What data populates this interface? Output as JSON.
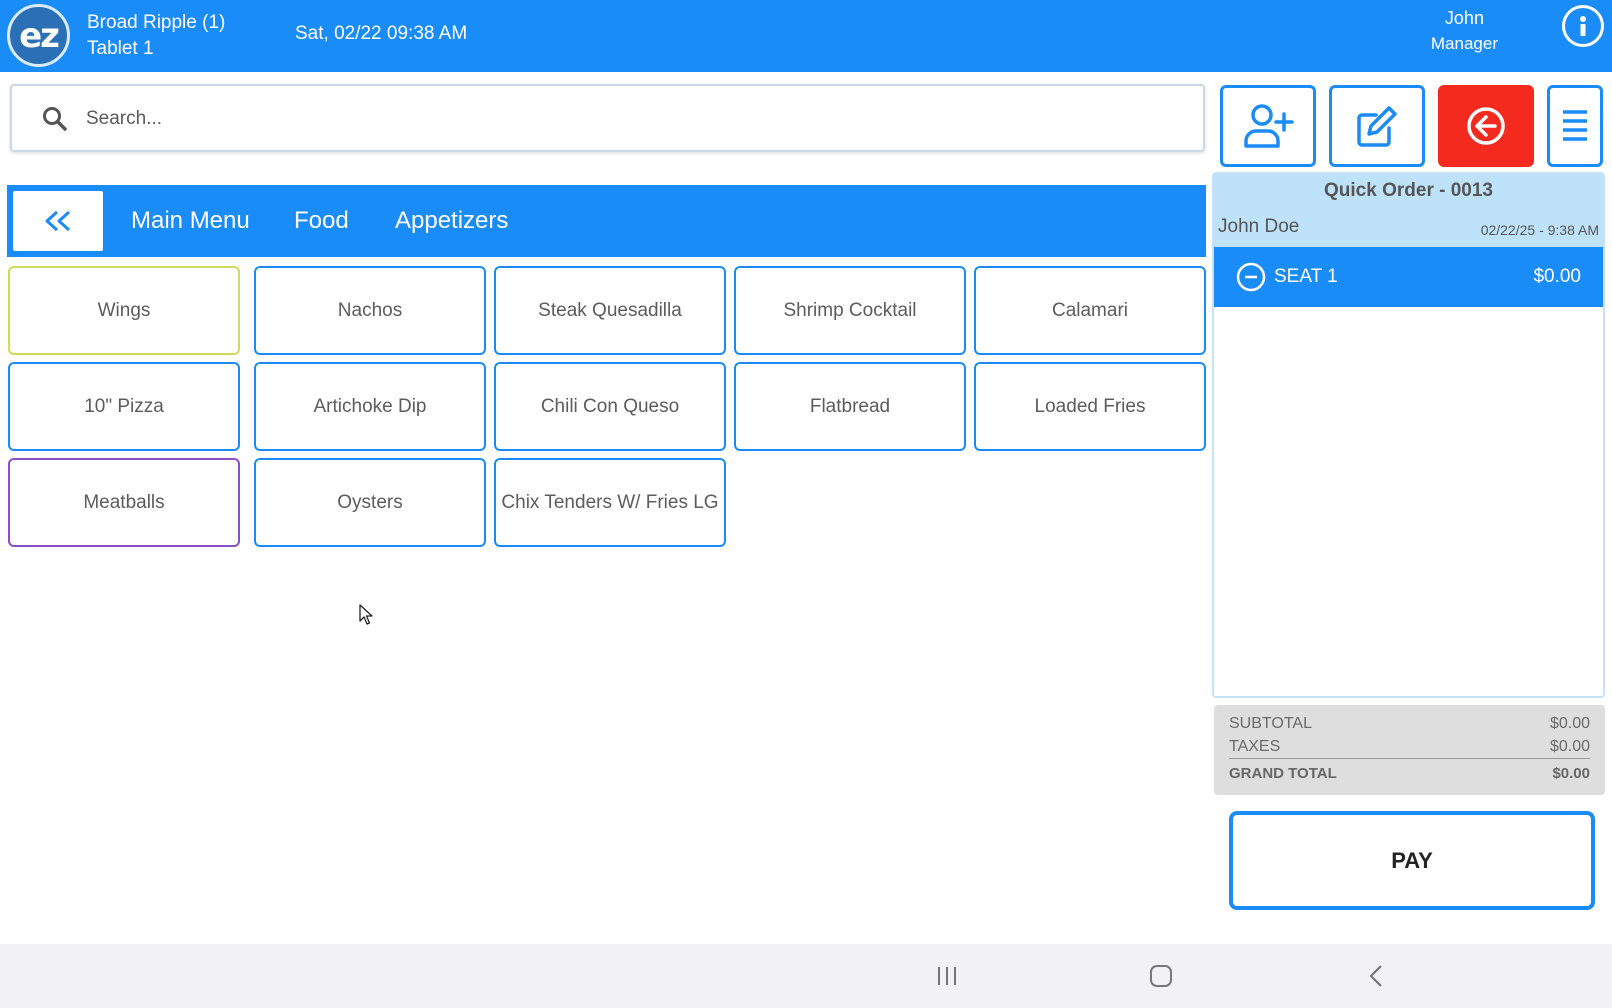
{
  "header": {
    "logo_text": "ez",
    "location": "Broad Ripple (1)",
    "device": "Tablet 1",
    "datetime": "Sat, 02/22 09:38 AM",
    "user_name": "John",
    "user_role": "Manager",
    "bg_color": "#1a8cf7"
  },
  "search": {
    "placeholder": "Search...",
    "value": ""
  },
  "toolbar": {
    "icons": [
      "add-customer-icon",
      "edit-icon",
      "back-arrow-icon",
      "hamburger-menu-icon"
    ]
  },
  "breadcrumb": {
    "items": [
      "Main Menu",
      "Food",
      "Appetizers"
    ]
  },
  "menu_items": [
    {
      "label": "Wings",
      "border": "#d3d95a"
    },
    {
      "label": "Nachos",
      "border": "#1a8cf7"
    },
    {
      "label": "Steak Quesadilla",
      "border": "#1a8cf7"
    },
    {
      "label": "Shrimp Cocktail",
      "border": "#1a8cf7"
    },
    {
      "label": "Calamari",
      "border": "#1a8cf7"
    },
    {
      "label": "10\" Pizza",
      "border": "#1a8cf7"
    },
    {
      "label": "Artichoke Dip",
      "border": "#1a8cf7"
    },
    {
      "label": "Chili Con Queso",
      "border": "#1a8cf7"
    },
    {
      "label": "Flatbread",
      "border": "#1a8cf7"
    },
    {
      "label": "Loaded Fries",
      "border": "#1a8cf7"
    },
    {
      "label": "Meatballs",
      "border": "#8a4fc2"
    },
    {
      "label": "Oysters",
      "border": "#1a8cf7"
    },
    {
      "label": "Chix Tenders W/ Fries LG",
      "border": "#1a8cf7"
    }
  ],
  "order": {
    "title": "Quick Order - 0013",
    "customer": "John Doe",
    "timestamp": "02/22/25 - 9:38 AM",
    "seat_label": "SEAT 1",
    "seat_amount": "$0.00"
  },
  "totals": {
    "subtotal_label": "SUBTOTAL",
    "subtotal": "$0.00",
    "taxes_label": "TAXES",
    "taxes": "$0.00",
    "grand_label": "GRAND TOTAL",
    "grand": "$0.00"
  },
  "pay_label": "PAY",
  "colors": {
    "accent": "#1a8cf7",
    "danger": "#f52a1e"
  }
}
